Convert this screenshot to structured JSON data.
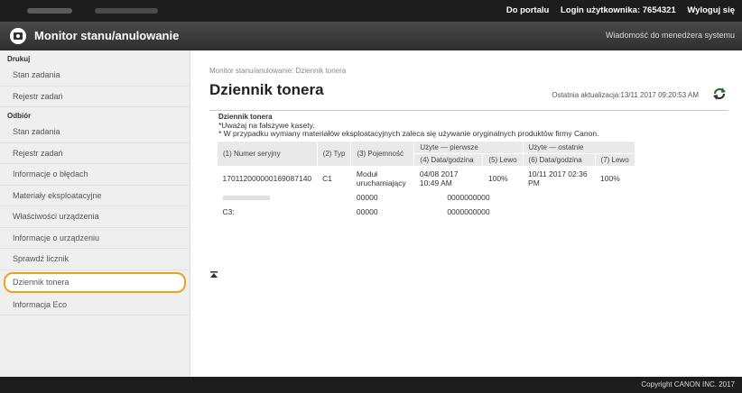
{
  "topbar": {
    "portal_link": "Do portalu",
    "login_label": "Login użytkownika: 7654321",
    "logout": "Wyloguj się"
  },
  "header": {
    "title": "Monitor stanu/anulowanie",
    "message": "Wiadomość do menedżera systemu"
  },
  "sidebar": {
    "print_group": "Drukuj",
    "print_items": [
      "Stan zadania",
      "Rejestr zadań"
    ],
    "receive_group": "Odbiór",
    "receive_items": [
      "Stan zadania",
      "Rejestr zadań"
    ],
    "other_items": [
      "Informacje o błędach",
      "Materiały eksploatacyjne",
      "Właściwości urządzenia",
      "Informacje o urządzeniu",
      "Sprawdź licznik",
      "Dziennik tonera",
      "Informacja Eco"
    ]
  },
  "main": {
    "breadcrumb": "Monitor stanu/anulowanie: Dziennik tonera",
    "title": "Dziennik tonera",
    "last_update": "Ostatnia aktualizacja:13/11 2017 09:20:53 AM",
    "section": "Dziennik tonera",
    "note1": "*Uważaj na fałszywe kasety.",
    "note2": "* W przypadku wymiany materiałów eksploatacyjnych zaleca się używanie oryginalnych produktów firmy Canon.",
    "group_first": "Użyte — pierwsze",
    "group_last": "Użyte — ostatnie",
    "headers": [
      "(1) Numer seryjny",
      "(2) Typ",
      "(3) Pojemność",
      "(4) Data/godzina",
      "(5) Lewo",
      "(6) Data/godzina",
      "(7) Lewo"
    ],
    "rows": [
      {
        "serial": "1701120000001690871​40",
        "type": "C1",
        "capacity": "Moduł uruchamiający",
        "first_date": "04/08 2017 10:49 AM",
        "first_left": "100%",
        "last_date": "10/11 2017 02:36 PM",
        "last_left": "100%"
      },
      {
        "serial": "",
        "type": "",
        "capacity": "00000",
        "first_date": "0000000000",
        "first_left": "",
        "last_date": "",
        "last_left": ""
      },
      {
        "serial": "C3:",
        "type": "",
        "capacity": "00000",
        "first_date": "0000000000",
        "first_left": "",
        "last_date": "",
        "last_left": ""
      }
    ]
  },
  "footer": {
    "copyright": "Copyright CANON INC. 2017"
  }
}
